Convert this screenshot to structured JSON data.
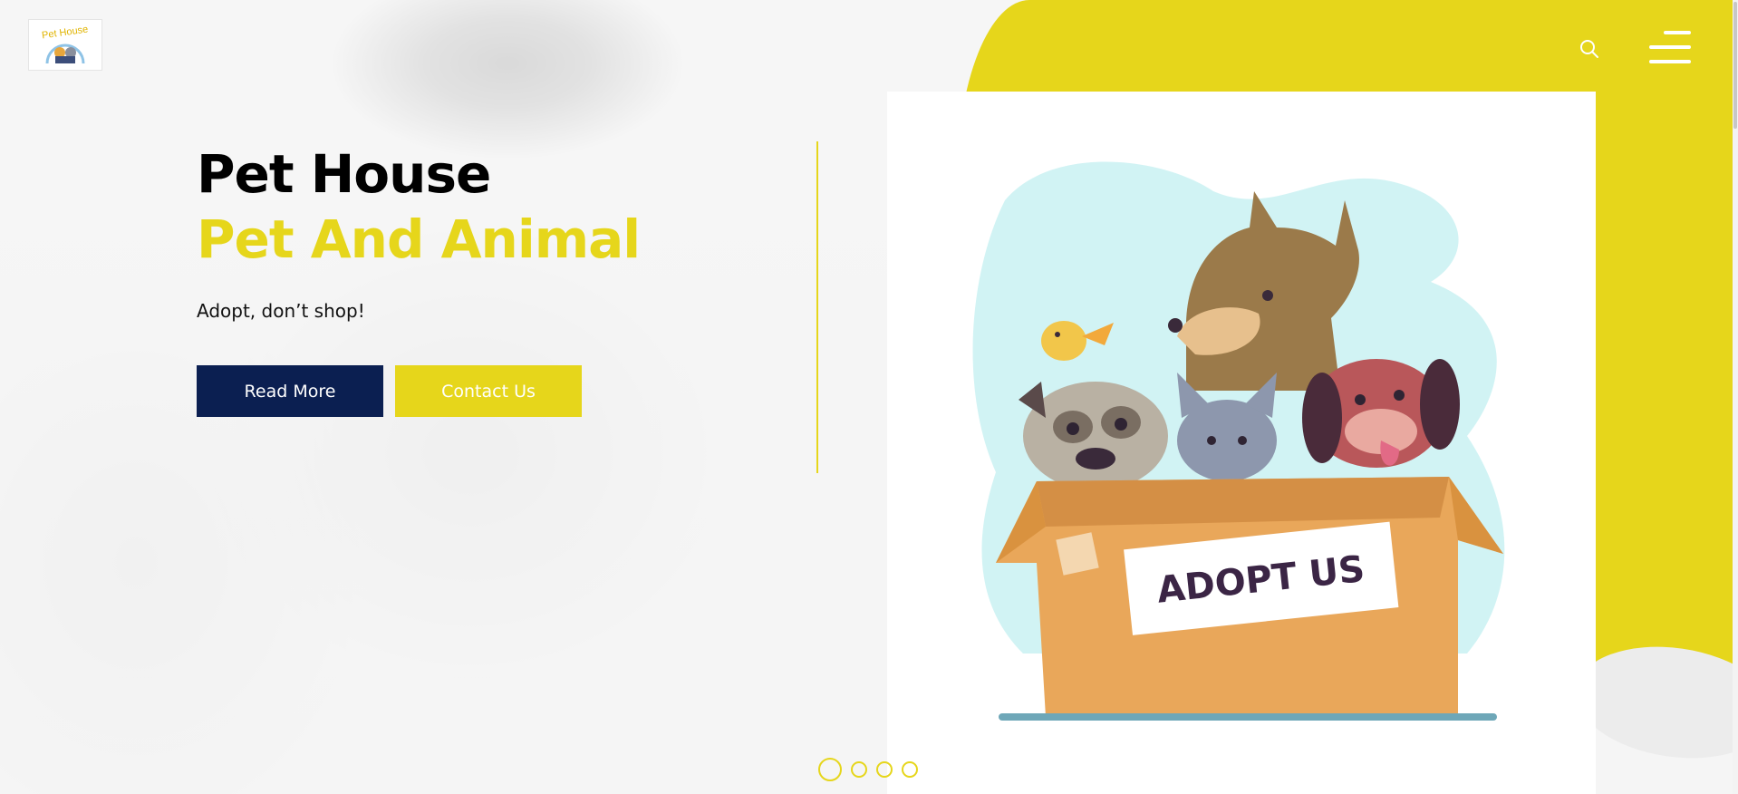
{
  "brand": {
    "logo_text": "Pet House",
    "accent_color": "#e6d61b",
    "primary_color": "#0b1f51"
  },
  "header": {
    "search_icon": "search-icon",
    "menu_icon": "hamburger-menu-icon"
  },
  "hero": {
    "title": "Pet House",
    "subtitle": "Pet And Animal",
    "tagline": "Adopt, don’t shop!",
    "read_more_label": "Read More",
    "contact_label": "Contact Us"
  },
  "illustration": {
    "box_label": "ADOPT US"
  },
  "carousel": {
    "slide_count": 4,
    "active_index": 0
  }
}
